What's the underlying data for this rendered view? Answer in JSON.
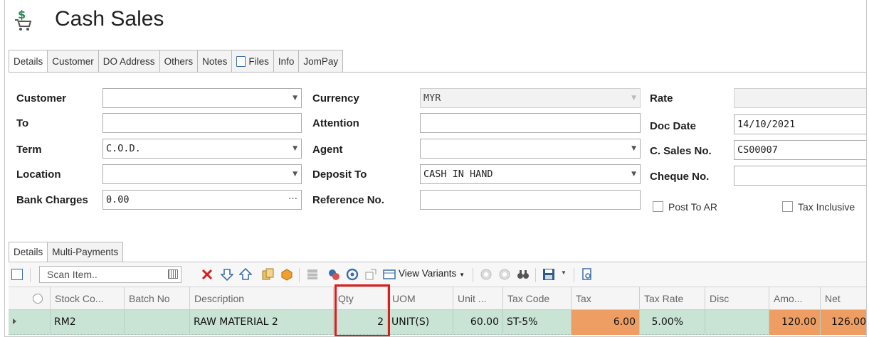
{
  "window": {
    "title": "Cash Sales"
  },
  "tabs": [
    "Details",
    "Customer",
    "DO Address",
    "Others",
    "Notes",
    "Files",
    "Info",
    "JomPay"
  ],
  "form": {
    "customer": {
      "label": "Customer",
      "value": ""
    },
    "to": {
      "label": "To",
      "value": ""
    },
    "term": {
      "label": "Term",
      "value": "C.O.D."
    },
    "location": {
      "label": "Location",
      "value": ""
    },
    "bank_charges": {
      "label": "Bank Charges",
      "value": "0.00"
    },
    "currency": {
      "label": "Currency",
      "value": "MYR"
    },
    "attention": {
      "label": "Attention",
      "value": ""
    },
    "agent": {
      "label": "Agent",
      "value": ""
    },
    "deposit_to": {
      "label": "Deposit To",
      "value": "CASH IN HAND"
    },
    "reference_no": {
      "label": "Reference No.",
      "value": ""
    },
    "rate": {
      "label": "Rate",
      "value": ""
    },
    "doc_date": {
      "label": "Doc Date",
      "value": "14/10/2021"
    },
    "c_sales_no": {
      "label": "C. Sales No.",
      "value": "CS00007"
    },
    "cheque_no": {
      "label": "Cheque No.",
      "value": ""
    },
    "post_to_ar": {
      "label": "Post To AR",
      "checked": false
    },
    "tax_inclusive": {
      "label": "Tax Inclusive",
      "checked": false
    }
  },
  "lower_tabs": [
    "Details",
    "Multi-Payments"
  ],
  "toolbar": {
    "scan_placeholder": "Scan Item..",
    "view_variants": "View Variants"
  },
  "grid": {
    "columns": [
      "Stock Co...",
      "Batch No",
      "Description",
      "Qty",
      "UOM",
      "Unit ...",
      "Tax Code",
      "Tax",
      "Tax Rate",
      "Disc",
      "Amo...",
      "Net"
    ],
    "rows": [
      {
        "stock_code": "RM2",
        "batch_no": "",
        "description": "RAW MATERIAL 2",
        "qty": "2",
        "uom": "UNIT(S)",
        "unit_price": "60.00",
        "tax_code": "ST-5%",
        "tax": "6.00",
        "tax_rate": "5.00%",
        "disc": "",
        "amount": "120.00",
        "net": "126.00"
      }
    ]
  },
  "colors": {
    "row_bg": "#c9e3d5",
    "highlight_cell": "#ef9e63",
    "callout_border": "#e01b1b"
  }
}
